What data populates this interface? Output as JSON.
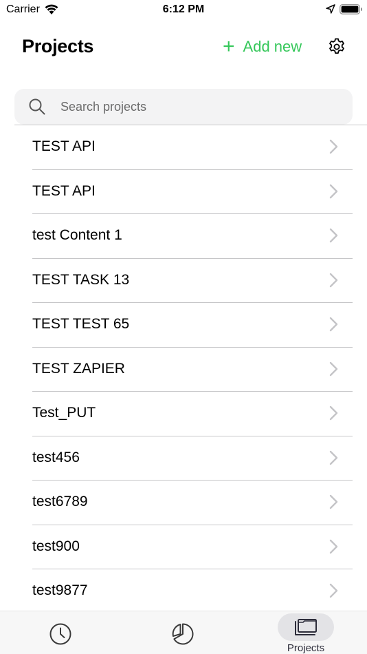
{
  "status_bar": {
    "carrier": "Carrier",
    "time": "6:12 PM"
  },
  "header": {
    "title": "Projects",
    "add_new_label": "Add new",
    "add_icon": "plus-icon",
    "settings_icon": "gear-icon"
  },
  "search": {
    "placeholder": "Search projects",
    "value": "",
    "icon": "search-icon"
  },
  "projects": [
    {
      "name": "TEST API"
    },
    {
      "name": "TEST API"
    },
    {
      "name": "test Content 1"
    },
    {
      "name": "TEST TASK 13"
    },
    {
      "name": "TEST TEST 65"
    },
    {
      "name": "TEST ZAPIER"
    },
    {
      "name": "Test_PUT"
    },
    {
      "name": "test456"
    },
    {
      "name": "test6789"
    },
    {
      "name": "test900"
    },
    {
      "name": "test9877"
    }
  ],
  "tab_bar": {
    "tabs": [
      {
        "icon": "clock-icon",
        "label": ""
      },
      {
        "icon": "pie-chart-icon",
        "label": ""
      },
      {
        "icon": "folders-icon",
        "label": "Projects",
        "active": true
      }
    ]
  },
  "colors": {
    "accent": "#34c759",
    "separator": "#c6c6c8",
    "search_bg": "#f3f3f4",
    "tab_active_bg": "#e3e3e6"
  }
}
